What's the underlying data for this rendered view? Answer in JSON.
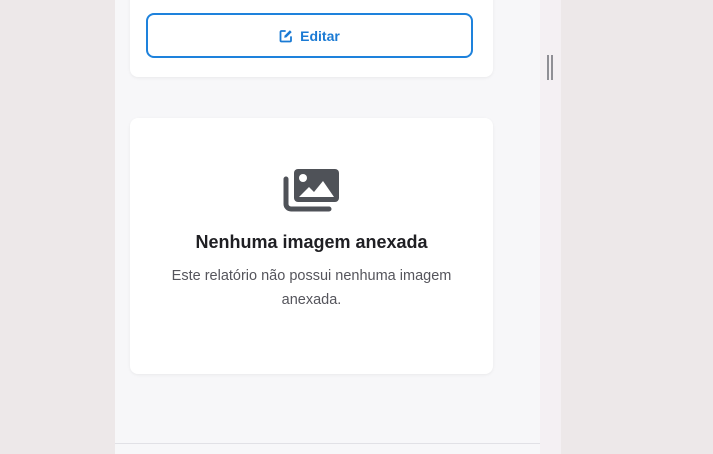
{
  "edit_button": {
    "label": "Editar",
    "icon": "edit-icon",
    "color": "#1a7ad4"
  },
  "empty_state": {
    "icon": "images-icon",
    "title": "Nenhuma imagem anexada",
    "message": "Este relatório não possui nenhuma imagem anexada."
  }
}
